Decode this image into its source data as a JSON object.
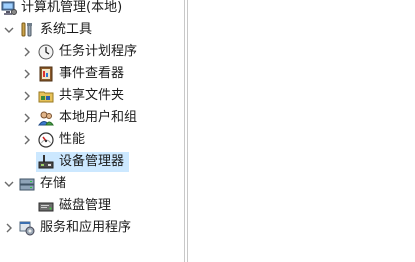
{
  "tree": {
    "root": {
      "label": "计算机管理(本地)",
      "icon": "computer-management-icon"
    },
    "system_tools": {
      "label": "系统工具",
      "icon": "tools-icon",
      "expanded": true
    },
    "task_scheduler": {
      "label": "任务计划程序",
      "icon": "clock-icon"
    },
    "event_viewer": {
      "label": "事件查看器",
      "icon": "event-viewer-icon"
    },
    "shared_folders": {
      "label": "共享文件夹",
      "icon": "shared-folder-icon"
    },
    "local_users": {
      "label": "本地用户和组",
      "icon": "users-icon"
    },
    "performance": {
      "label": "性能",
      "icon": "performance-icon"
    },
    "device_manager": {
      "label": "设备管理器",
      "icon": "device-manager-icon",
      "selected": true
    },
    "storage": {
      "label": "存储",
      "icon": "storage-icon",
      "expanded": true
    },
    "disk_management": {
      "label": "磁盘管理",
      "icon": "disk-icon"
    },
    "services_apps": {
      "label": "服务和应用程序",
      "icon": "services-icon",
      "expanded": false
    }
  },
  "colors": {
    "selection": "#cce8ff",
    "divider": "#c8c8c8",
    "chevron": "#6b6b6b"
  }
}
